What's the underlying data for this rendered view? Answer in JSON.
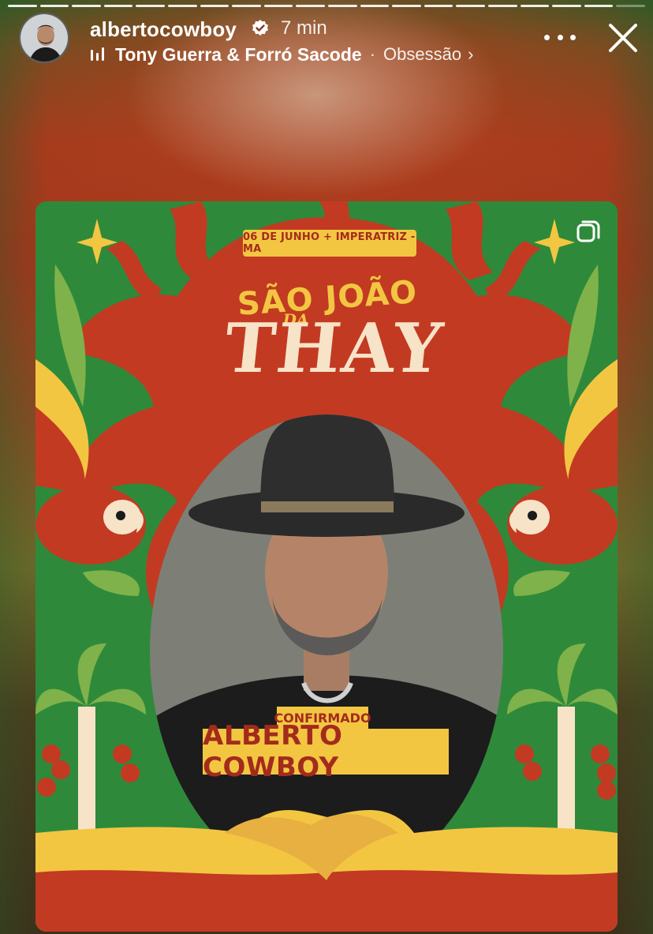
{
  "story": {
    "progress": {
      "total_segments": 20,
      "viewed_segments": 19
    },
    "header": {
      "username": "albertocowboy",
      "verified": true,
      "time_ago": "7 min",
      "music": {
        "artist": "Tony Guerra & Forró Sacode",
        "separator": "·",
        "song": "Obsessão",
        "chevron": "›"
      },
      "more_icon": "more-horizontal-icon",
      "close_icon": "close-icon"
    }
  },
  "poster": {
    "date_line": "06 DE JUNHO + IMPERATRIZ - MA",
    "logo": {
      "line1": "SÃO JOÃO",
      "line2": "DA",
      "line3": "THAY"
    },
    "confirm_label": "CONFIRMADO",
    "artist_name": "ALBERTO COWBOY",
    "multi_post_icon": "multiple-posts-icon"
  },
  "colors": {
    "poster_green": "#2e8a3a",
    "poster_red": "#c23a22",
    "poster_yellow": "#f3c642",
    "poster_cream": "#f7e3c7",
    "text_red": "#a32b1d"
  }
}
